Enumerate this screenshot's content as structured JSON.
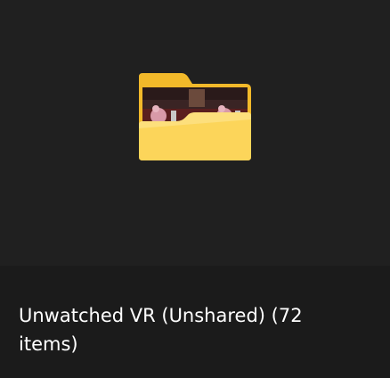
{
  "tile": {
    "title": "Unwatched VR (Unshared) (72 items)",
    "icon": "folder-icon"
  },
  "colors": {
    "background": "#202020",
    "caption_background": "#1b1b1b",
    "folder_yellow": "#fcd55a",
    "folder_back": "#f2b92a",
    "text": "#ffffff"
  }
}
